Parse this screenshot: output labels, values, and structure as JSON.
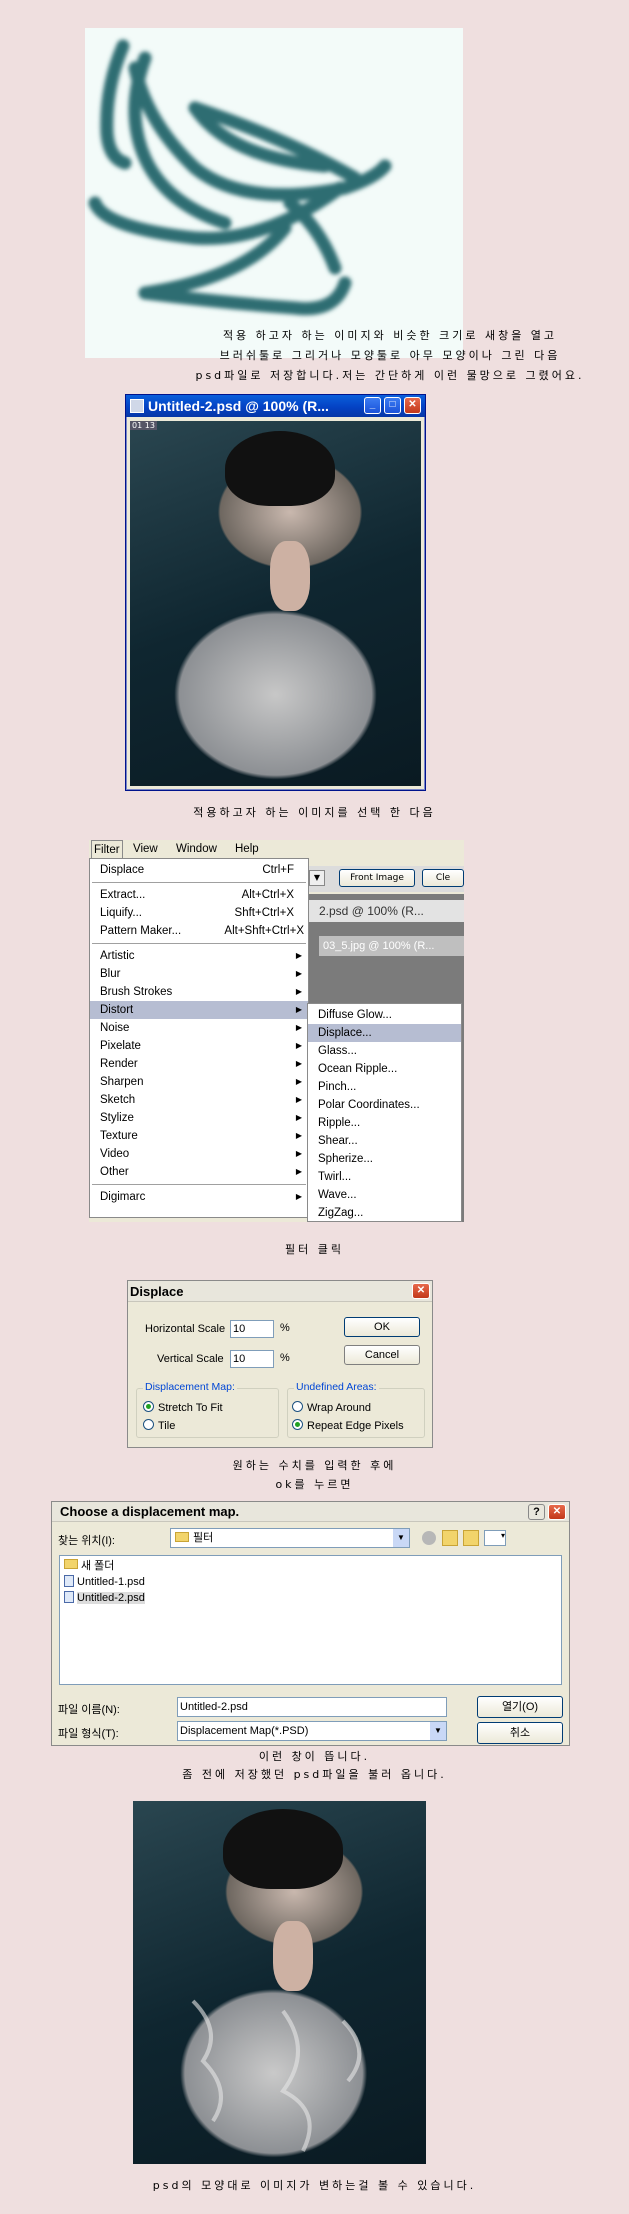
{
  "section1": {
    "caption_lines": [
      "적용 하고자 하는 이미지와 비슷한 크기로 새창을 열고",
      "브러쉬툴로 그리거나 모양툴로 아무 모양이나 그린 다음",
      "psd파일로 저장합니다.저는 간단하게 이런 물망으로 그렸어요."
    ]
  },
  "doc_window": {
    "title": "Untitled-2.psd @ 100% (R...",
    "badge": "01 13"
  },
  "section2": {
    "caption": "적용하고자 하는 이미지를 선택 한 다음"
  },
  "filter_menu": {
    "menubar": [
      "Filter",
      "View",
      "Window",
      "Help"
    ],
    "top_items": [
      {
        "label": "Displace",
        "shortcut": "Ctrl+F"
      }
    ],
    "group1": [
      {
        "label": "Extract...",
        "shortcut": "Alt+Ctrl+X"
      },
      {
        "label": "Liquify...",
        "shortcut": "Shft+Ctrl+X"
      },
      {
        "label": "Pattern Maker...",
        "shortcut": "Alt+Shft+Ctrl+X"
      }
    ],
    "submenus": [
      "Artistic",
      "Blur",
      "Brush Strokes",
      "Distort",
      "Noise",
      "Pixelate",
      "Render",
      "Sharpen",
      "Sketch",
      "Stylize",
      "Texture",
      "Video",
      "Other"
    ],
    "selected": "Distort",
    "last": "Digimarc",
    "toolbar_button": "Front Image",
    "toolbar_button2": "Cle",
    "behind_title": "03_5.jpg @ 100% (R...",
    "behind_title2": "2.psd @ 100% (R..."
  },
  "distort_submenu": {
    "items": [
      "Diffuse Glow...",
      "Displace...",
      "Glass...",
      "Ocean Ripple...",
      "Pinch...",
      "Polar Coordinates...",
      "Ripple...",
      "Shear...",
      "Spherize...",
      "Twirl...",
      "Wave...",
      "ZigZag..."
    ],
    "selected": "Displace..."
  },
  "section3": {
    "caption": "필터 클릭"
  },
  "displace_dialog": {
    "title": "Displace",
    "h_label": "Horizontal Scale",
    "h_value": "10",
    "v_label": "Vertical Scale",
    "v_value": "10",
    "unit": "%",
    "ok": "OK",
    "cancel": "Cancel",
    "map_group": "Displacement Map:",
    "stretch": "Stretch To Fit",
    "tile": "Tile",
    "undef_group": "Undefined Areas:",
    "wrap": "Wrap Around",
    "repeat": "Repeat Edge Pixels"
  },
  "section4": {
    "caption_lines": [
      "원하는 수치를 입력한 후에",
      "ok를 누르면"
    ]
  },
  "open_dialog": {
    "title": "Choose a displacement map.",
    "look_in_label": "찾는 위치(I):",
    "look_in_value": "필터",
    "files": [
      "새 폴더",
      "Untitled-1.psd",
      "Untitled-2.psd"
    ],
    "filename_label": "파일 이름(N):",
    "filename_value": "Untitled-2.psd",
    "filetype_label": "파일 형식(T):",
    "filetype_value": "Displacement Map(*.PSD)",
    "open": "열기(O)",
    "cancel": "취소",
    "help": "?"
  },
  "section5": {
    "caption_lines": [
      "이런 창이 뜹니다.",
      "좀 전에 저장했던 psd파일을 불러 옵니다."
    ]
  },
  "section6": {
    "caption": "psd의 모양대로 이미지가 변하는걸 볼 수 있습니다."
  },
  "colors": {
    "background": "#efdfdf",
    "stroke": "#2e6d72",
    "xp_blue": "#0442c4"
  }
}
